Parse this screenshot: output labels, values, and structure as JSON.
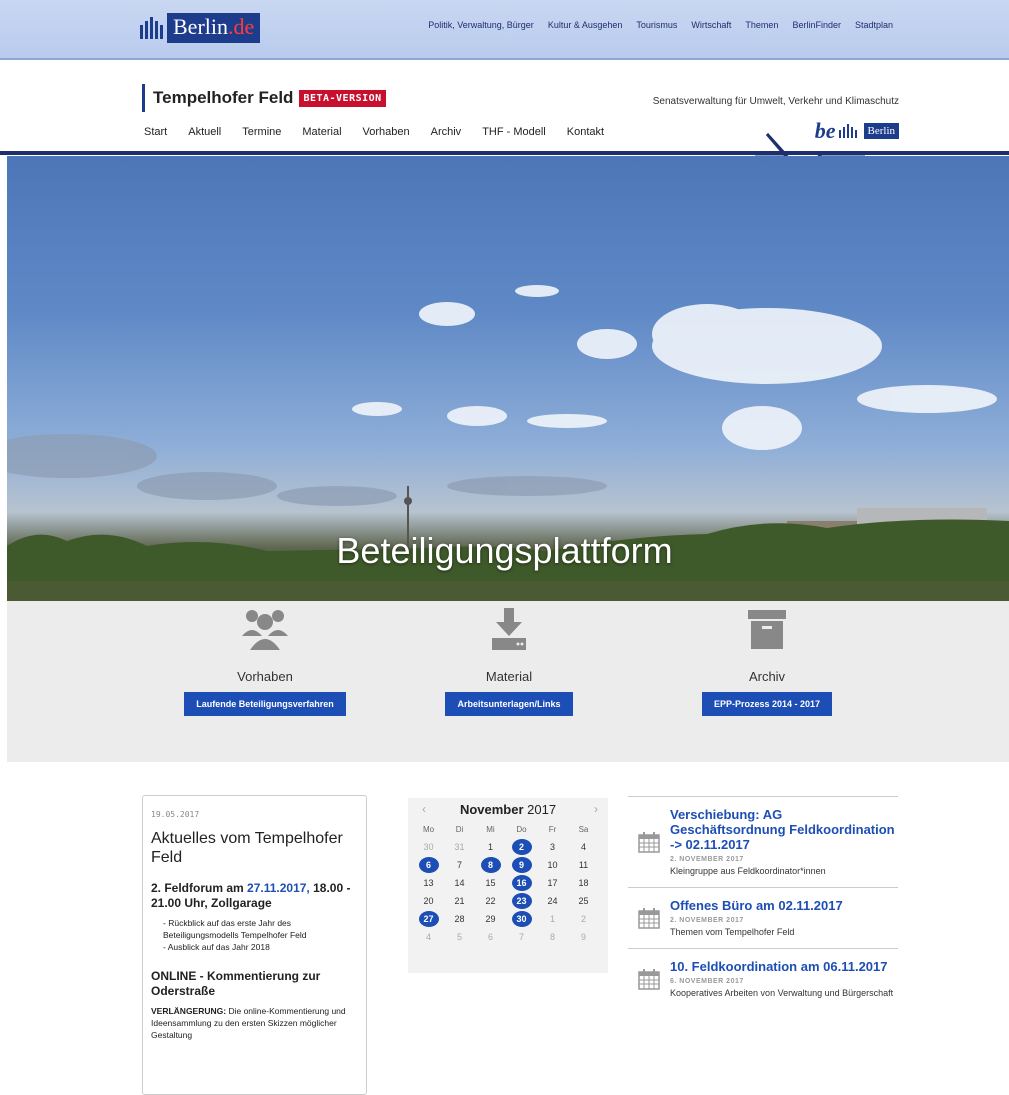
{
  "topbar": {
    "logo_text": "Berlin",
    "logo_tld": ".de",
    "nav": [
      "Politik, Verwaltung, Bürger",
      "Kultur & Ausgehen",
      "Tourismus",
      "Wirtschaft",
      "Themen",
      "BerlinFinder",
      "Stadtplan"
    ]
  },
  "header": {
    "site_title": "Tempelhofer Feld",
    "beta_badge": "BETA-VERSION",
    "department": "Senatsverwaltung für Umwelt, Verkehr und Klimaschutz",
    "be_logo": "be",
    "berlin_logo": "Berlin",
    "nav": [
      "Start",
      "Aktuell",
      "Termine",
      "Material",
      "Vorhaben",
      "Archiv",
      "THF - Modell",
      "Kontakt"
    ]
  },
  "hero": {
    "title": "Beteiligungsplattform"
  },
  "features": [
    {
      "icon": "users-icon",
      "label": "Vorhaben",
      "button": "Laufende Beteiligungsverfahren"
    },
    {
      "icon": "download-icon",
      "label": "Material",
      "button": "Arbeitsunterlagen/Links"
    },
    {
      "icon": "archive-box-icon",
      "label": "Archiv",
      "button": "EPP-Prozess 2014 - 2017"
    }
  ],
  "news": {
    "date": "19.05.2017",
    "title": "Aktuelles vom Tempelhofer Feld",
    "item1_title_prefix": "2. Feldforum am ",
    "item1_title_date": "27.11.2017,",
    "item1_title_rest": "18.00 - 21.00 Uhr, Zollgarage",
    "item1_points": [
      "Rückblick auf das erste Jahr des Beteiligungsmodells Tempelhofer Feld",
      "Ausblick auf das Jahr 2018"
    ],
    "item2_title": "ONLINE - Kommentierung zur Oderstraße",
    "item2_lead": "VERLÄNGERUNG:",
    "item2_text": " Die online-Kommentierung und Ideensammlung zu den ersten Skizzen möglicher Gestaltung"
  },
  "calendar": {
    "prev": "‹",
    "next": "›",
    "month": "November",
    "year": "2017",
    "weekdays": [
      "Mo",
      "Di",
      "Mi",
      "Do",
      "Fr",
      "Sa"
    ],
    "weeks": [
      [
        "30",
        "31",
        "1",
        "2",
        "3",
        "4"
      ],
      [
        "6",
        "7",
        "8",
        "9",
        "10",
        "11"
      ],
      [
        "13",
        "14",
        "15",
        "16",
        "17",
        "18"
      ],
      [
        "20",
        "21",
        "22",
        "23",
        "24",
        "25"
      ],
      [
        "27",
        "28",
        "29",
        "30",
        "1",
        "2"
      ],
      [
        "4",
        "5",
        "6",
        "7",
        "8",
        "9"
      ]
    ],
    "highlighted": [
      "2",
      "6",
      "8",
      "9",
      "16",
      "23",
      "27",
      "30"
    ],
    "accent_color": "#1d4eb5"
  },
  "events": [
    {
      "title": "Verschiebung: AG Geschäftsordnung Feldkoordination -> 02.11.2017",
      "date": "2. NOVEMBER 2017",
      "desc": "Kleingruppe aus Feldkoordinator*innen"
    },
    {
      "title": "Offenes Büro am 02.11.2017",
      "date": "2. NOVEMBER 2017",
      "desc": "Themen vom Tempelhofer Feld"
    },
    {
      "title": "10. Feldkoordination am 06.11.2017",
      "date": "6. NOVEMBER 2017",
      "desc": "Kooperatives Arbeiten von Verwaltung und Bürgerschaft"
    }
  ]
}
